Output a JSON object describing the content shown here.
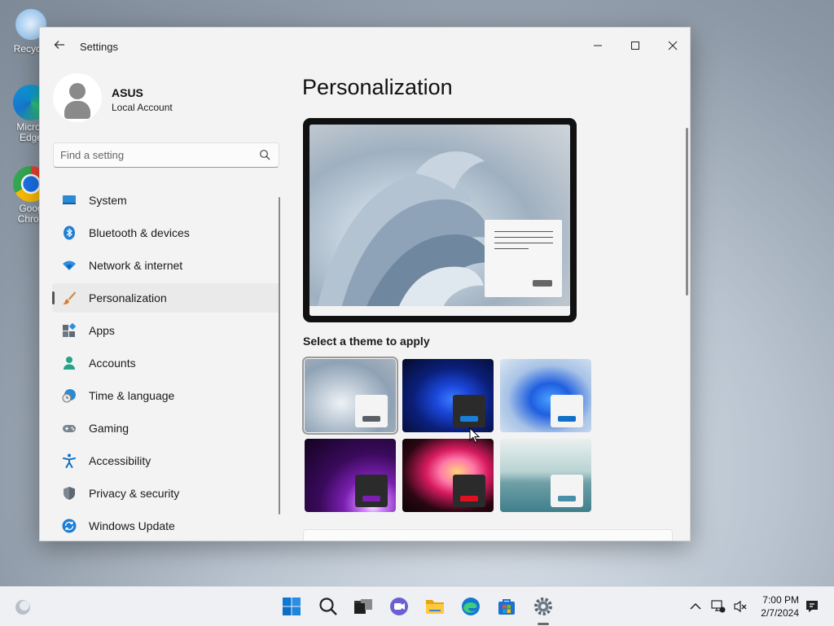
{
  "desktop": {
    "icons": [
      {
        "label": "Recycle"
      },
      {
        "label": "Micros Edge"
      },
      {
        "label": "Goog Chron"
      }
    ]
  },
  "window": {
    "app_title": "Settings",
    "back_icon": "arrow-left-icon",
    "controls": {
      "minimize": "—",
      "maximize": "▢",
      "close": "✕"
    }
  },
  "sidebar": {
    "user": {
      "name": "ASUS",
      "type": "Local Account"
    },
    "search": {
      "placeholder": "Find a setting",
      "value": ""
    },
    "items": [
      {
        "label": "System",
        "icon": "monitor-icon",
        "selected": false
      },
      {
        "label": "Bluetooth & devices",
        "icon": "bluetooth-icon",
        "selected": false
      },
      {
        "label": "Network & internet",
        "icon": "wifi-icon",
        "selected": false
      },
      {
        "label": "Personalization",
        "icon": "paintbrush-icon",
        "selected": true
      },
      {
        "label": "Apps",
        "icon": "apps-icon",
        "selected": false
      },
      {
        "label": "Accounts",
        "icon": "person-icon",
        "selected": false
      },
      {
        "label": "Time & language",
        "icon": "globe-clock-icon",
        "selected": false
      },
      {
        "label": "Gaming",
        "icon": "gamepad-icon",
        "selected": false
      },
      {
        "label": "Accessibility",
        "icon": "accessibility-icon",
        "selected": false
      },
      {
        "label": "Privacy & security",
        "icon": "shield-icon",
        "selected": false
      },
      {
        "label": "Windows Update",
        "icon": "update-icon",
        "selected": false
      }
    ]
  },
  "main": {
    "title": "Personalization",
    "theme_heading": "Select a theme to apply",
    "themes": [
      {
        "name": "windows-light",
        "selected": true,
        "accent": "#5a5f66",
        "mini": "#f4f4f4"
      },
      {
        "name": "windows-dark",
        "selected": false,
        "accent": "#1a7fd9",
        "mini": "#2b2b2b"
      },
      {
        "name": "windows-glow",
        "selected": false,
        "accent": "#1170c8",
        "mini": "#f4f4f4"
      },
      {
        "name": "captured-motion",
        "selected": false,
        "accent": "#7a1fb0",
        "mini": "#2b2b2b"
      },
      {
        "name": "flow",
        "selected": false,
        "accent": "#e01020",
        "mini": "#2b2b2b"
      },
      {
        "name": "sunrise",
        "selected": false,
        "accent": "#4a8fa8",
        "mini": "#f4f4f4"
      }
    ]
  },
  "taskbar": {
    "icons": [
      "weather-icon",
      "start-icon",
      "search-icon",
      "task-view-icon",
      "teams-chat-icon",
      "file-explorer-icon",
      "edge-icon",
      "store-icon",
      "settings-icon"
    ],
    "tray": [
      "chevron-up-icon",
      "network-icon",
      "volume-muted-icon",
      "notification-icon"
    ],
    "time": "7:00 PM",
    "date": "2/7/2024"
  }
}
